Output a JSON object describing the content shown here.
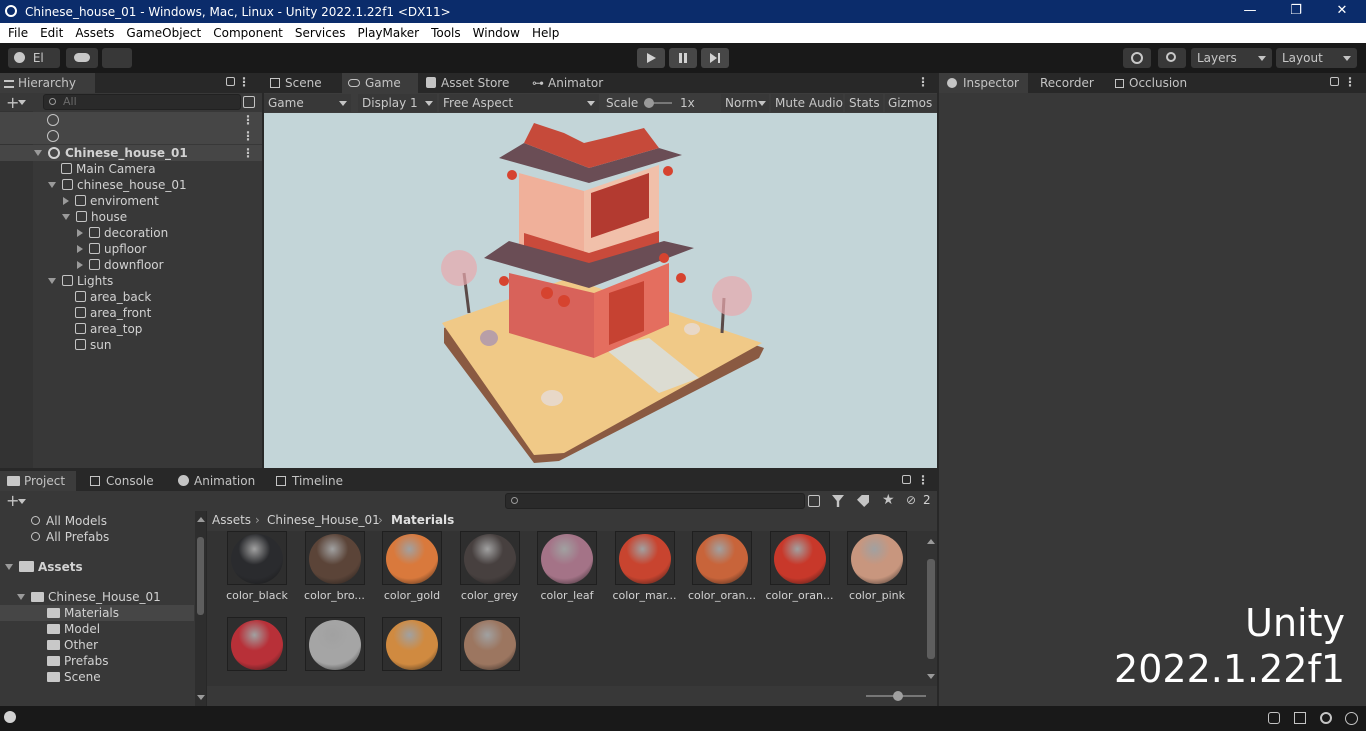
{
  "titlebar": {
    "title": "Chinese_house_01 - Windows, Mac, Linux - Unity 2022.1.22f1 <DX11>",
    "minimize": "—",
    "restore": "❐",
    "close": "✕"
  },
  "menu": [
    "File",
    "Edit",
    "Assets",
    "GameObject",
    "Component",
    "Services",
    "PlayMaker",
    "Tools",
    "Window",
    "Help"
  ],
  "toolbar": {
    "account_label": "El",
    "layers_label": "Layers",
    "layout_label": "Layout"
  },
  "hierarchy": {
    "tab_label": "Hierarchy",
    "search_placeholder": "All",
    "rows": [
      {
        "label": "",
        "type": "unity"
      },
      {
        "label": "",
        "type": "unity"
      },
      {
        "label": "Chinese_house_01",
        "type": "scene"
      },
      {
        "label": "Main Camera",
        "type": "obj"
      },
      {
        "label": "chinese_house_01",
        "type": "obj"
      },
      {
        "label": "enviroment",
        "type": "obj"
      },
      {
        "label": "house",
        "type": "obj"
      },
      {
        "label": "decoration",
        "type": "obj"
      },
      {
        "label": "upfloor",
        "type": "obj"
      },
      {
        "label": "downfloor",
        "type": "obj"
      },
      {
        "label": "Lights",
        "type": "obj"
      },
      {
        "label": "area_back",
        "type": "obj"
      },
      {
        "label": "area_front",
        "type": "obj"
      },
      {
        "label": "area_top",
        "type": "obj"
      },
      {
        "label": "sun",
        "type": "obj"
      }
    ]
  },
  "center_tabs": {
    "scene": "Scene",
    "game": "Game",
    "asset_store": "Asset Store",
    "animator": "Animator"
  },
  "game_toolbar": {
    "game": "Game",
    "display": "Display 1",
    "aspect": "Free Aspect",
    "scale_label": "Scale",
    "scale_value": "1x",
    "normal": "Norm",
    "mute": "Mute Audio",
    "stats": "Stats",
    "gizmos": "Gizmos"
  },
  "right_tabs": {
    "inspector": "Inspector",
    "recorder": "Recorder",
    "occlusion": "Occlusion"
  },
  "bottom_tabs": {
    "project": "Project",
    "console": "Console",
    "animation": "Animation",
    "timeline": "Timeline"
  },
  "project": {
    "hidden_count": "2",
    "favorites": [
      "All Models",
      "All Prefabs"
    ],
    "assets_label": "Assets",
    "folders": [
      "Chinese_House_01",
      "Materials",
      "Model",
      "Other",
      "Prefabs",
      "Scene"
    ],
    "breadcrumb": [
      "Assets",
      "Chinese_House_01",
      "Materials"
    ],
    "materials": [
      {
        "name": "color_black",
        "color": "#2a2b2e"
      },
      {
        "name": "color_bro...",
        "color": "#5b4438"
      },
      {
        "name": "color_gold",
        "color": "#d9793c"
      },
      {
        "name": "color_grey",
        "color": "#47403f"
      },
      {
        "name": "color_leaf",
        "color": "#a47387"
      },
      {
        "name": "color_mar...",
        "color": "#c8442f"
      },
      {
        "name": "color_oran...",
        "color": "#c8643a"
      },
      {
        "name": "color_oran...",
        "color": "#c8382a"
      },
      {
        "name": "color_pink",
        "color": "#c8967e"
      },
      {
        "name": "",
        "color": "#b83038"
      },
      {
        "name": "",
        "color": "#a5a5a5"
      },
      {
        "name": "",
        "color": "#d08a40"
      },
      {
        "name": "",
        "color": "#9c7660"
      }
    ]
  },
  "watermark": {
    "line1": "Unity",
    "line2": "2022.1.22f1"
  }
}
